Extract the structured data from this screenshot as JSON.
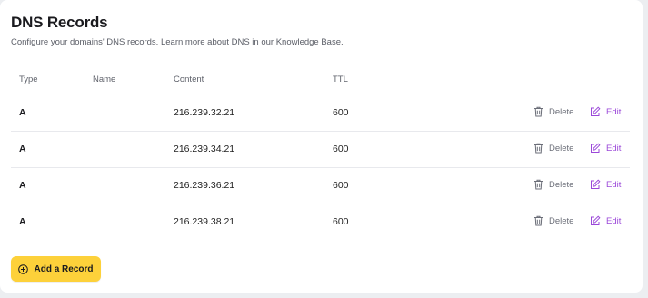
{
  "page": {
    "title": "DNS Records",
    "subtitle": "Configure your domains' DNS records. Learn more about DNS in our Knowledge Base."
  },
  "table": {
    "headers": {
      "type": "Type",
      "name": "Name",
      "content": "Content",
      "ttl": "TTL"
    },
    "rows": [
      {
        "type": "A",
        "name": "",
        "content": "216.239.32.21",
        "ttl": "600",
        "delete_label": "Delete",
        "edit_label": "Edit"
      },
      {
        "type": "A",
        "name": "",
        "content": "216.239.34.21",
        "ttl": "600",
        "delete_label": "Delete",
        "edit_label": "Edit"
      },
      {
        "type": "A",
        "name": "",
        "content": "216.239.36.21",
        "ttl": "600",
        "delete_label": "Delete",
        "edit_label": "Edit"
      },
      {
        "type": "A",
        "name": "",
        "content": "216.239.38.21",
        "ttl": "600",
        "delete_label": "Delete",
        "edit_label": "Edit"
      }
    ]
  },
  "add_button": {
    "label": "Add a Record",
    "icon": "plus-circle-icon"
  },
  "icons": {
    "delete": "trash-icon",
    "edit": "edit-icon"
  },
  "colors": {
    "accent_button": "#fdd13a",
    "edit_link": "#9b48d9",
    "delete_link": "#6b6e78"
  }
}
